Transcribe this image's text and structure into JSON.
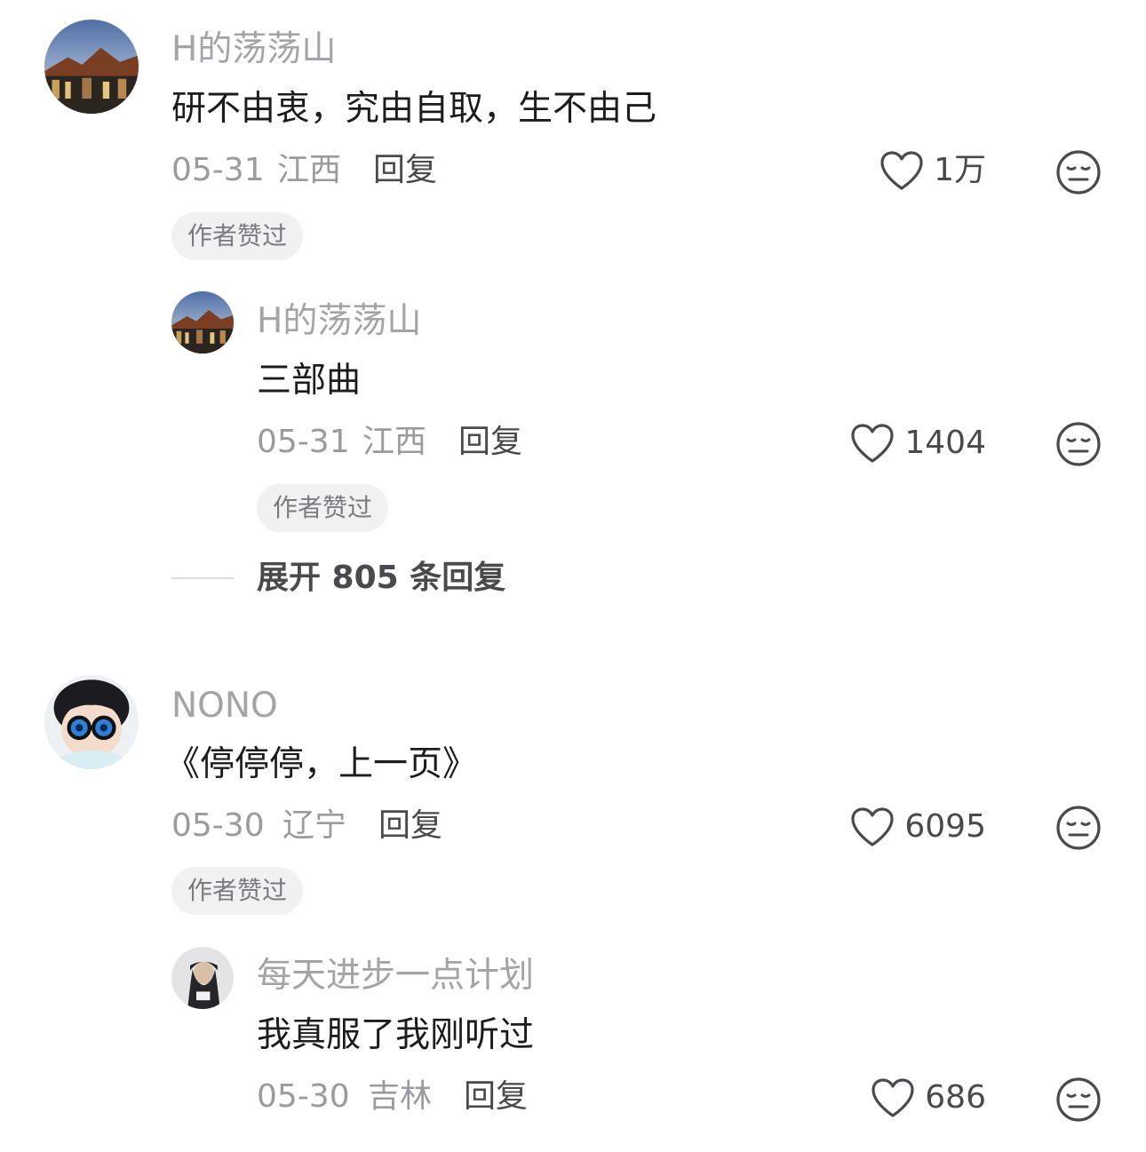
{
  "comments": [
    {
      "username": "H的荡荡山",
      "text": "研不由衷，究由自取，生不由己",
      "date": "05-31",
      "location": "江西",
      "reply_label": "回复",
      "likes": "1万",
      "badge": "作者赞过",
      "avatar_icon": "landscape-avatar"
    },
    {
      "username": "H的荡荡山",
      "text": "三部曲",
      "date": "05-31",
      "location": "江西",
      "reply_label": "回复",
      "likes": "1404",
      "badge": "作者赞过",
      "avatar_icon": "landscape-avatar"
    },
    {
      "username": "NONO",
      "text": "《停停停，上一页》",
      "date": "05-30",
      "location": "辽宁",
      "reply_label": "回复",
      "likes": "6095",
      "badge": "作者赞过",
      "avatar_icon": "cartoon-avatar"
    },
    {
      "username": "每天进步一点计划",
      "text": "我真服了我刚听过",
      "date": "05-30",
      "location": "吉林",
      "reply_label": "回复",
      "likes": "686",
      "avatar_icon": "person-avatar"
    }
  ],
  "expand_replies": "展开 805 条回复",
  "colors": {
    "username": "#a3a3a8",
    "text": "#1c1c1e",
    "meta": "#9a9a9f",
    "action": "#4a4a4e",
    "badge_bg": "#f1f1f3"
  },
  "icons": {
    "like": "heart-outline-icon",
    "dislike": "meh-face-icon"
  }
}
